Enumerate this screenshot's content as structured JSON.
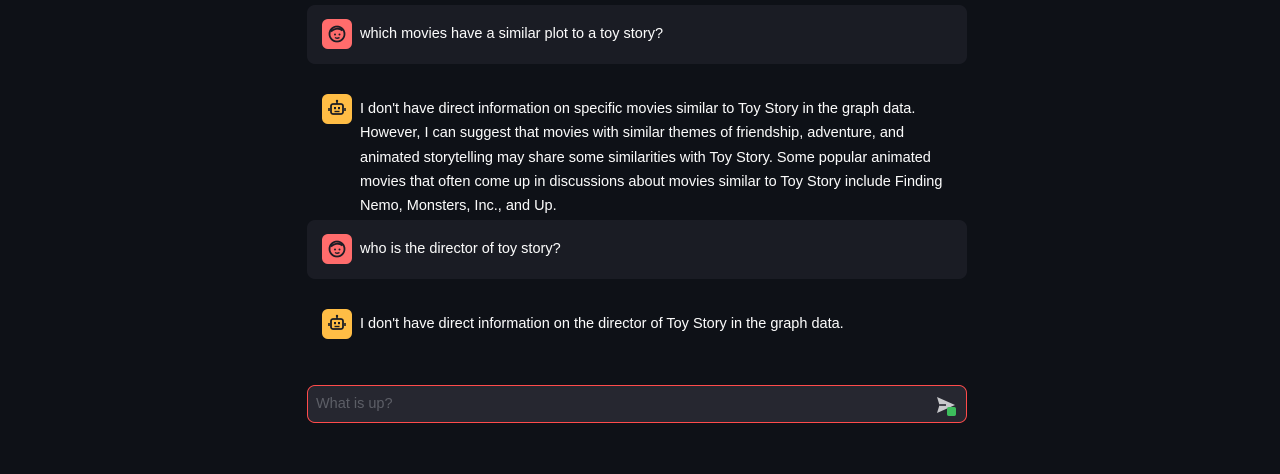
{
  "messages": [
    {
      "role": "user",
      "avatar_icon": "user-face-icon",
      "text": "which movies have a similar plot to a toy story?"
    },
    {
      "role": "assistant",
      "avatar_icon": "robot-icon",
      "text": "I don't have direct information on specific movies similar to Toy Story in the graph data. However, I can suggest that movies with similar themes of friendship, adventure, and animated storytelling may share some similarities with Toy Story. Some popular animated movies that often come up in discussions about movies similar to Toy Story include Finding Nemo, Monsters, Inc., and Up."
    },
    {
      "role": "user",
      "avatar_icon": "user-face-icon",
      "text": "who is the director of toy story?"
    },
    {
      "role": "assistant",
      "avatar_icon": "robot-icon",
      "text": "I don't have direct information on the director of Toy Story in the graph data."
    }
  ],
  "chat_input": {
    "placeholder": "What is up?",
    "value": "",
    "send_icon": "send-icon"
  },
  "colors": {
    "background": "#0e1117",
    "user_message_bg": "#1a1c24",
    "user_avatar": "#ff6c6c",
    "assistant_avatar": "#ffbd45",
    "input_bg": "#262730",
    "input_border": "#ff4b4b"
  }
}
